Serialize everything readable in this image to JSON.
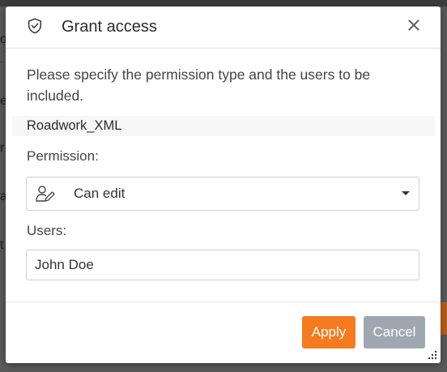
{
  "background": {
    "fragments": [
      "o",
      "e",
      "r",
      "a",
      "t"
    ],
    "button_fragment": "p"
  },
  "dialog": {
    "title": "Grant access",
    "close_label": "✕",
    "description": "Please specify the permission type and the users to be included.",
    "item_name": "Roadwork_XML",
    "permission": {
      "label": "Permission:",
      "selected": "Can edit"
    },
    "users": {
      "label": "Users:",
      "value": "John Doe"
    },
    "buttons": {
      "apply": "Apply",
      "cancel": "Cancel"
    }
  },
  "colors": {
    "accent": "#f47b20",
    "cancel": "#9fa8b1",
    "overlay": "#5a5a5a"
  },
  "icons": [
    "shield-check-icon",
    "close-icon",
    "user-edit-icon",
    "chevron-down-icon",
    "resize-grip-icon"
  ]
}
